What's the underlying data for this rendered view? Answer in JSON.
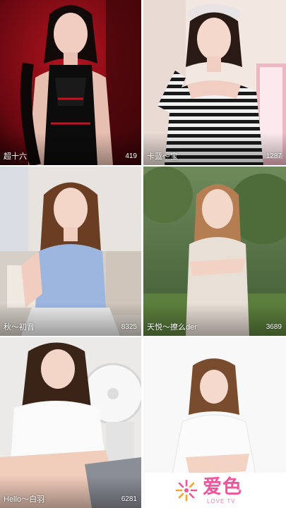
{
  "cards": [
    {
      "name": "超十六",
      "count": "419"
    },
    {
      "name": "卡蓝～宝",
      "count": "1287"
    },
    {
      "name": "秋～初音",
      "count": "8325"
    },
    {
      "name": "天悦～撩么der",
      "count": "3689"
    },
    {
      "name": "Hello～白羽",
      "count": "6281"
    },
    {
      "name": "",
      "count": ""
    }
  ],
  "brand": {
    "name": "爱色",
    "subtitle": "LOVE TV",
    "icon": "flower-logo-icon"
  },
  "colors": {
    "brand_pink": "#f0559b",
    "brand_orange": "#f5a623",
    "overlay_text": "#ffffff"
  }
}
